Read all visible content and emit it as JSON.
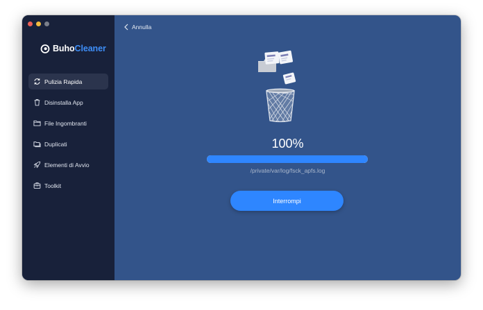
{
  "app": {
    "brand_part1": "Buho",
    "brand_part2": "Cleaner",
    "brand_color": "#3e8ef7",
    "icon": "buho-owl-logo-icon"
  },
  "sidebar": {
    "items": [
      {
        "label": "Pulizia Rapida",
        "icon": "refresh-icon",
        "active": true
      },
      {
        "label": "Disinstalla App",
        "icon": "trash-icon",
        "active": false
      },
      {
        "label": "File Ingombranti",
        "icon": "folder-icon",
        "active": false
      },
      {
        "label": "Duplicati",
        "icon": "duplicate-folder-icon",
        "active": false
      },
      {
        "label": "Elementi di Avvio",
        "icon": "rocket-icon",
        "active": false
      },
      {
        "label": "Toolkit",
        "icon": "toolbox-icon",
        "active": false
      }
    ]
  },
  "main": {
    "back_label": "Annulla",
    "progress_percent": 100,
    "progress_text": "100%",
    "current_path": "/private/var/log/fsck_apfs.log",
    "stop_button_label": "Interrompi",
    "illustration_icon": "files-to-trash-icon"
  },
  "colors": {
    "sidebar_bg": "#18213a",
    "main_bg": "#33548a",
    "accent": "#2e86ff"
  }
}
